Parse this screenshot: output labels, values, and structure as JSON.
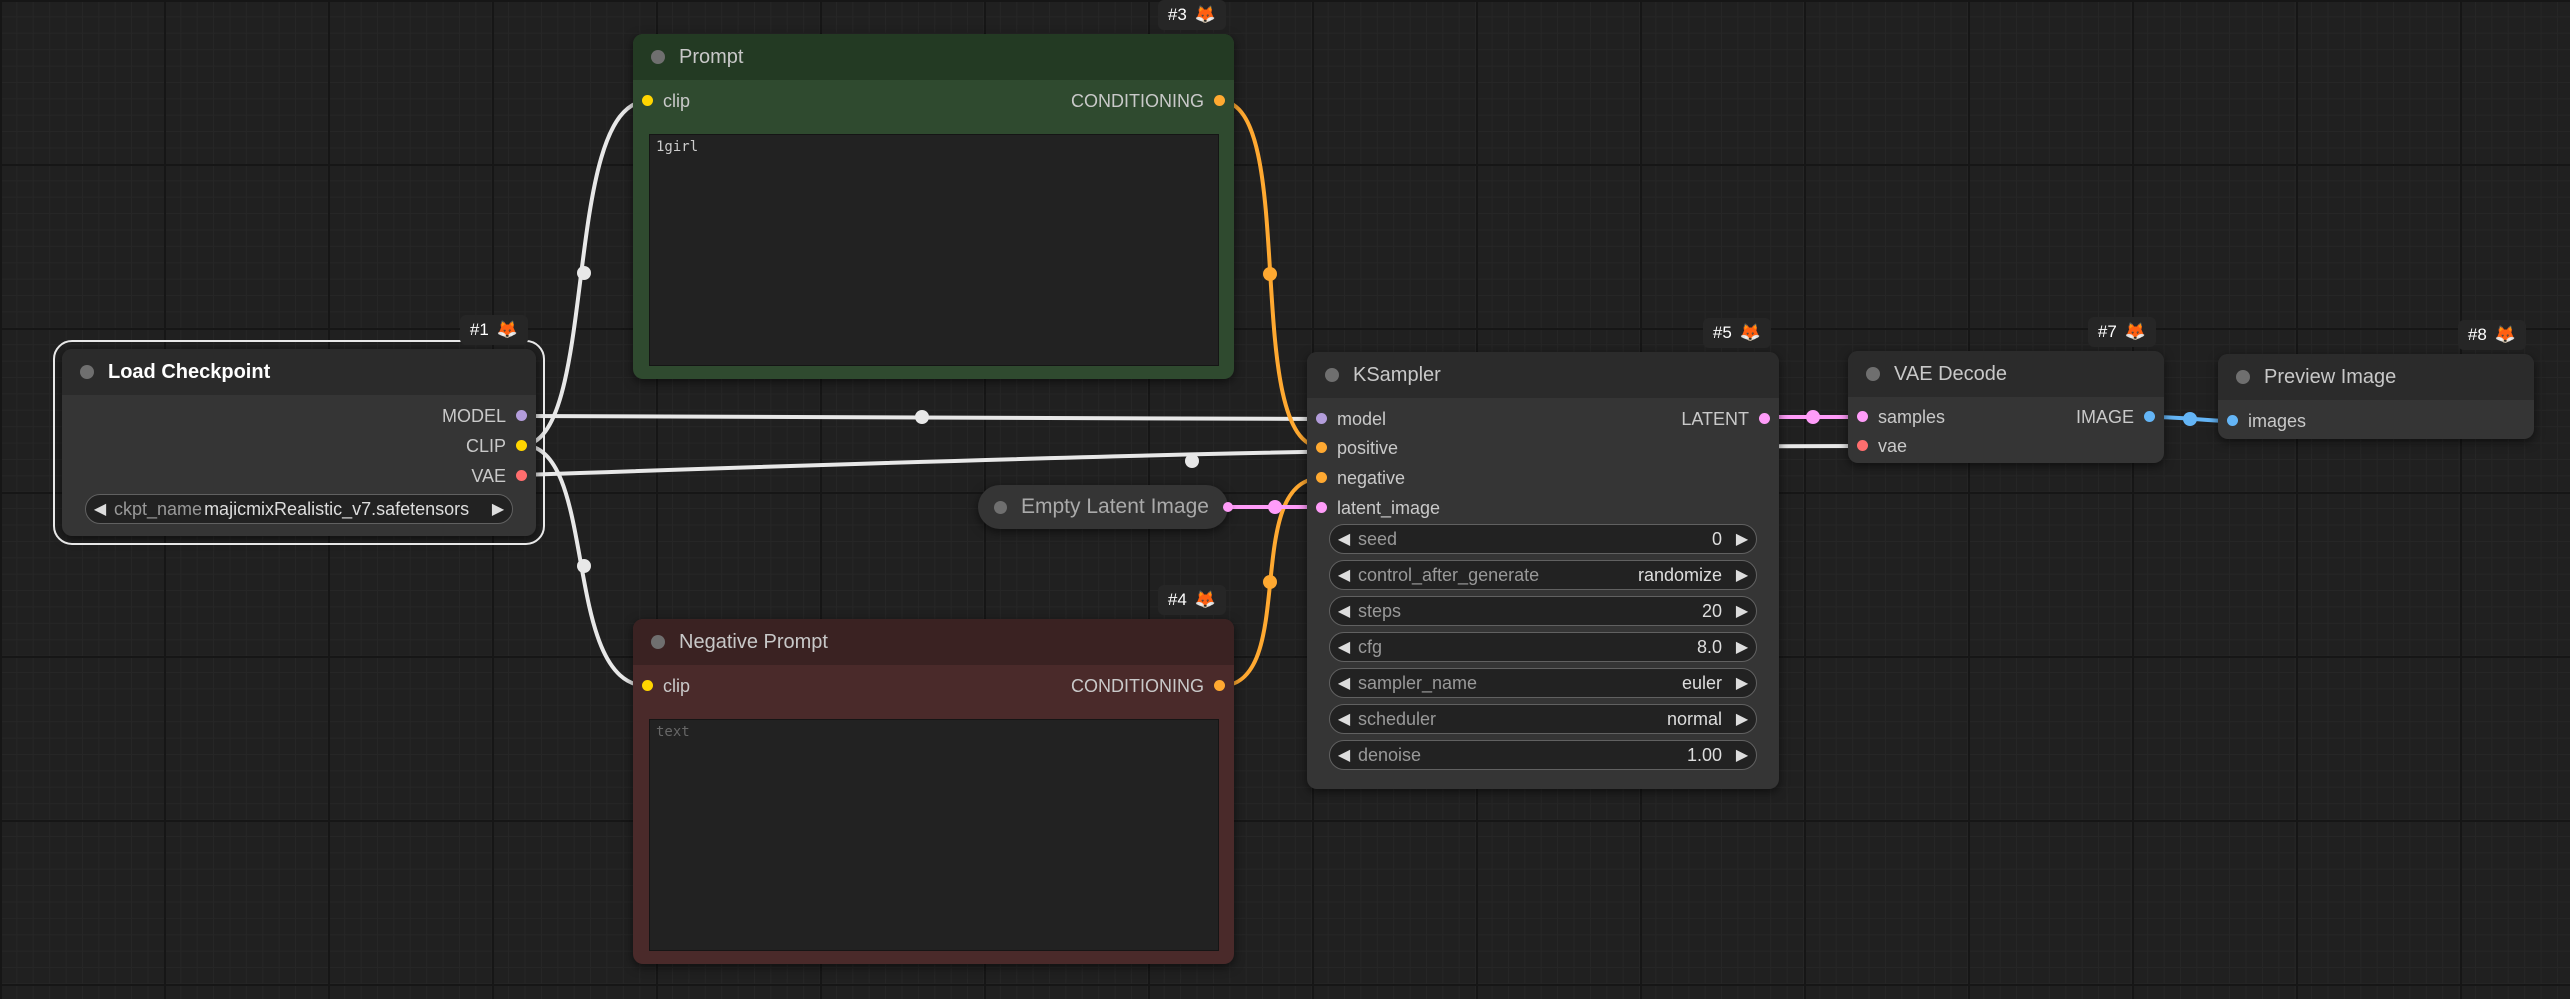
{
  "nodes": {
    "load_checkpoint": {
      "id": "#1",
      "title": "Load Checkpoint",
      "outputs": [
        "MODEL",
        "CLIP",
        "VAE"
      ],
      "widget": {
        "label": "ckpt_name",
        "value": "majicmixRealistic_v7.safetensors"
      }
    },
    "prompt": {
      "id": "#3",
      "title": "Prompt",
      "input": "clip",
      "output": "CONDITIONING",
      "text": "1girl"
    },
    "negative_prompt": {
      "id": "#4",
      "title": "Negative Prompt",
      "input": "clip",
      "output": "CONDITIONING",
      "placeholder": "text"
    },
    "empty_latent": {
      "title": "Empty Latent Image"
    },
    "ksampler": {
      "id": "#5",
      "title": "KSampler",
      "inputs": [
        "model",
        "positive",
        "negative",
        "latent_image"
      ],
      "output": "LATENT",
      "widgets": [
        {
          "label": "seed",
          "value": "0"
        },
        {
          "label": "control_after_generate",
          "value": "randomize"
        },
        {
          "label": "steps",
          "value": "20"
        },
        {
          "label": "cfg",
          "value": "8.0"
        },
        {
          "label": "sampler_name",
          "value": "euler"
        },
        {
          "label": "scheduler",
          "value": "normal"
        },
        {
          "label": "denoise",
          "value": "1.00"
        }
      ]
    },
    "vae_decode": {
      "id": "#7",
      "title": "VAE Decode",
      "inputs": [
        "samples",
        "vae"
      ],
      "output": "IMAGE"
    },
    "preview_image": {
      "id": "#8",
      "title": "Preview Image",
      "input": "images"
    }
  },
  "colors": {
    "model": "#b39ddb",
    "clip": "#ffd500",
    "vae": "#ff6e6e",
    "conditioning": "#ffa931",
    "latent": "#ff9cf9",
    "image": "#64b5f6",
    "prompt_body": "#2f4a2f",
    "prompt_title": "#233a23",
    "negative_body": "#4a2a2a",
    "negative_title": "#3a2222"
  },
  "icons": {
    "node_badge": "fox-icon",
    "widget_left": "left-arrow-icon",
    "widget_right": "right-arrow-icon"
  }
}
